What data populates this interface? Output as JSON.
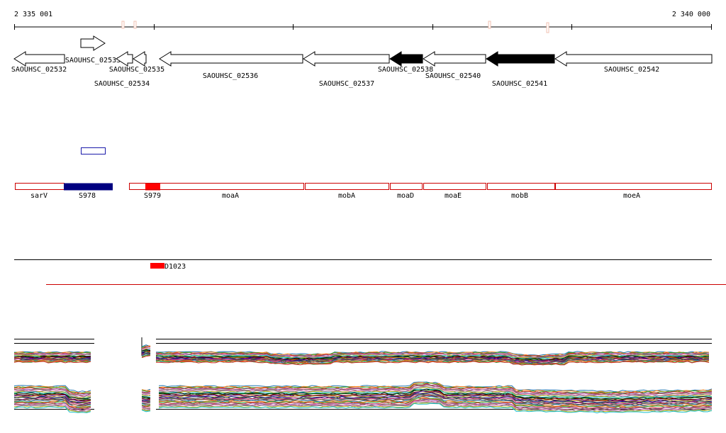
{
  "coordinates": {
    "start": "2 335 001",
    "end": "2 340 000"
  },
  "genes": [
    {
      "label": "SAOUHSC_02532",
      "strand": "-",
      "filled": false
    },
    {
      "label": "SAOUHSC_02533",
      "strand": "+",
      "filled": false
    },
    {
      "label": "SAOUHSC_02534",
      "strand": "-",
      "filled": false
    },
    {
      "label": "SAOUHSC_02535",
      "strand": "-",
      "filled": false
    },
    {
      "label": "SAOUHSC_02536",
      "strand": "-",
      "filled": false
    },
    {
      "label": "SAOUHSC_02537",
      "strand": "-",
      "filled": false
    },
    {
      "label": "SAOUHSC_02538",
      "strand": "-",
      "filled": true
    },
    {
      "label": "SAOUHSC_02540",
      "strand": "-",
      "filled": false
    },
    {
      "label": "SAOUHSC_02541",
      "strand": "-",
      "filled": true
    },
    {
      "label": "SAOUHSC_02542",
      "strand": "-",
      "filled": false
    }
  ],
  "annotations": [
    {
      "label": "sarV",
      "style": "outline"
    },
    {
      "label": "S978",
      "style": "navy"
    },
    {
      "label": "S979",
      "style": "red"
    },
    {
      "label": "moaA",
      "style": "outline"
    },
    {
      "label": "mobA",
      "style": "outline"
    },
    {
      "label": "moaD",
      "style": "outline"
    },
    {
      "label": "moaE",
      "style": "outline"
    },
    {
      "label": "mobB",
      "style": "outline"
    },
    {
      "label": "moeA",
      "style": "outline"
    }
  ],
  "feature_track": {
    "label": "D1023"
  },
  "colors": {
    "gene_outline": "#000000",
    "gene_fill_highlight": "#000000",
    "annotation_outline": "#cc0000",
    "annotation_navy": "#000080",
    "annotation_red": "#ff0000",
    "blue_box": "#1a1aaa",
    "red_line": "#cc0000"
  }
}
